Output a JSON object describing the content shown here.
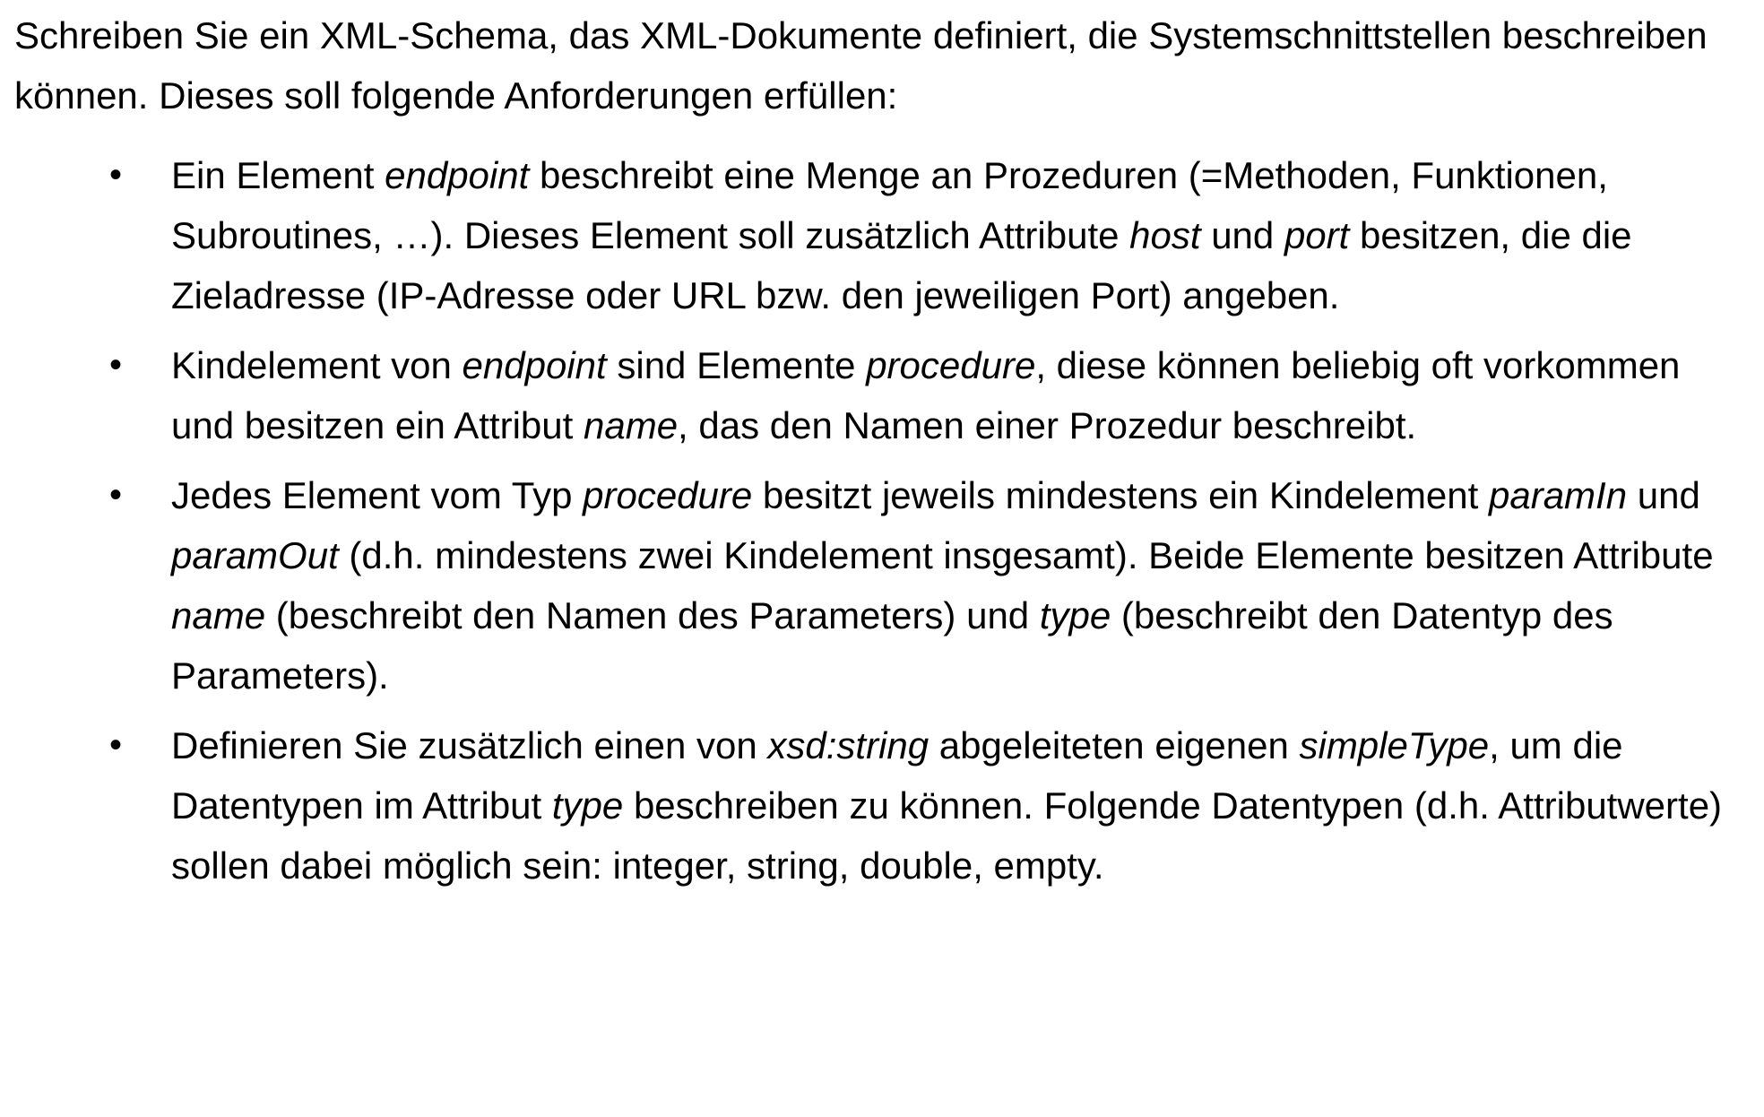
{
  "intro": "Schreiben Sie ein XML-Schema, das XML-Dokumente definiert, die Systemschnittstellen beschreiben können. Dieses soll folgende Anforderungen erfüllen:",
  "bullet_symbol": "•",
  "bullets": [
    [
      {
        "t": "Ein Element ",
        "i": false
      },
      {
        "t": "endpoint",
        "i": true
      },
      {
        "t": " beschreibt eine Menge an Prozeduren (=Methoden, Funktionen, Subroutines, …). Dieses Element soll zusätzlich Attribute ",
        "i": false
      },
      {
        "t": "host",
        "i": true
      },
      {
        "t": " und ",
        "i": false
      },
      {
        "t": "port",
        "i": true
      },
      {
        "t": " besitzen, die die Zieladresse (IP-Adresse oder URL bzw. den jeweiligen Port) angeben.",
        "i": false
      }
    ],
    [
      {
        "t": "Kindelement von ",
        "i": false
      },
      {
        "t": "endpoint",
        "i": true
      },
      {
        "t": " sind Elemente ",
        "i": false
      },
      {
        "t": "procedure",
        "i": true
      },
      {
        "t": ", diese können beliebig oft vorkommen und besitzen ein Attribut ",
        "i": false
      },
      {
        "t": "name",
        "i": true
      },
      {
        "t": ", das den Namen einer Prozedur beschreibt.",
        "i": false
      }
    ],
    [
      {
        "t": "Jedes Element vom Typ ",
        "i": false
      },
      {
        "t": "procedure",
        "i": true
      },
      {
        "t": " besitzt jeweils mindestens ein Kindelement ",
        "i": false
      },
      {
        "t": "paramIn",
        "i": true
      },
      {
        "t": " und ",
        "i": false
      },
      {
        "t": "paramOut",
        "i": true
      },
      {
        "t": " (d.h. mindestens zwei Kindelement insgesamt). Beide Elemente besitzen Attribute ",
        "i": false
      },
      {
        "t": "name",
        "i": true
      },
      {
        "t": " (beschreibt den Namen des Parameters) und ",
        "i": false
      },
      {
        "t": "type",
        "i": true
      },
      {
        "t": " (beschreibt den Datentyp des Parameters).",
        "i": false
      }
    ],
    [
      {
        "t": "Definieren Sie zusätzlich einen von ",
        "i": false
      },
      {
        "t": "xsd:string",
        "i": true
      },
      {
        "t": " abgeleiteten eigenen ",
        "i": false
      },
      {
        "t": "simpleType",
        "i": true
      },
      {
        "t": ", um die Datentypen im Attribut ",
        "i": false
      },
      {
        "t": "type",
        "i": true
      },
      {
        "t": " beschreiben zu können. Folgende Datentypen (d.h. Attributwerte) sollen dabei möglich sein: integer, string, double, empty.",
        "i": false
      }
    ]
  ]
}
